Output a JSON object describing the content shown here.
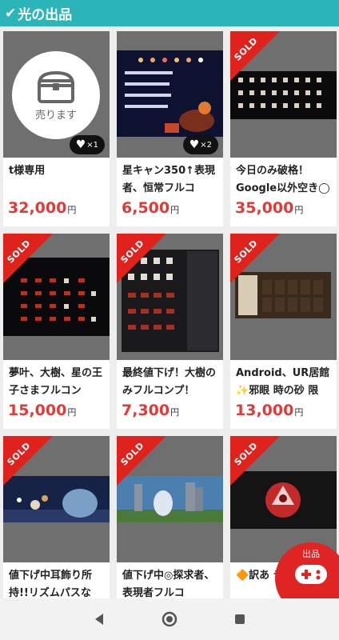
{
  "header": {
    "check_icon": "✔",
    "title": "光の出品"
  },
  "cards": [
    {
      "title": "t様専用",
      "price": "32,000",
      "yen": "円",
      "sold": false,
      "likes": "×1",
      "thumb": "sell-placeholder",
      "thumb_label": "売ります"
    },
    {
      "title": "星キャン350↑表現者、恒常フルコ",
      "price": "6,500",
      "yen": "円",
      "sold": false,
      "likes": "×2",
      "thumb": "game-scene"
    },
    {
      "title": "今日のみ破格！Google以外空き◯",
      "price": "35,000",
      "yen": "円",
      "sold": true,
      "sold_label": "SOLD",
      "thumb": "icon-grid"
    },
    {
      "title": "夢叶、大樹、星の王子さまフルコン",
      "price": "15,000",
      "yen": "円",
      "sold": true,
      "sold_label": "SOLD",
      "thumb": "icon-grid-red"
    },
    {
      "title": "最終値下げ！大樹のみフルコンプ！",
      "price": "7,300",
      "yen": "円",
      "sold": true,
      "sold_label": "SOLD",
      "thumb": "closet-grid"
    },
    {
      "title": "Android、UR居館✨邪眼 時の砂 限",
      "price": "13,000",
      "yen": "円",
      "sold": true,
      "sold_label": "SOLD",
      "thumb": "card-room"
    },
    {
      "title": "値下げ中耳飾り所持!!リズムパスな",
      "price": "",
      "yen": "",
      "sold": true,
      "sold_label": "SOLD",
      "thumb": "night-scene"
    },
    {
      "title": "値下げ中◎探求者、表現者フルコ",
      "price": "",
      "yen": "",
      "sold": true,
      "sold_label": "SOLD",
      "thumb": "stone-scene"
    },
    {
      "title": "🔶訳あ デターフ",
      "price": "",
      "yen": "",
      "sold": true,
      "sold_label": "SOLD",
      "thumb": "red-emblem"
    }
  ],
  "fab": {
    "label": "出品",
    "icon": "gamepad-icon"
  },
  "nav": {
    "back": "back-icon",
    "home": "home-icon",
    "recents": "recents-icon"
  }
}
